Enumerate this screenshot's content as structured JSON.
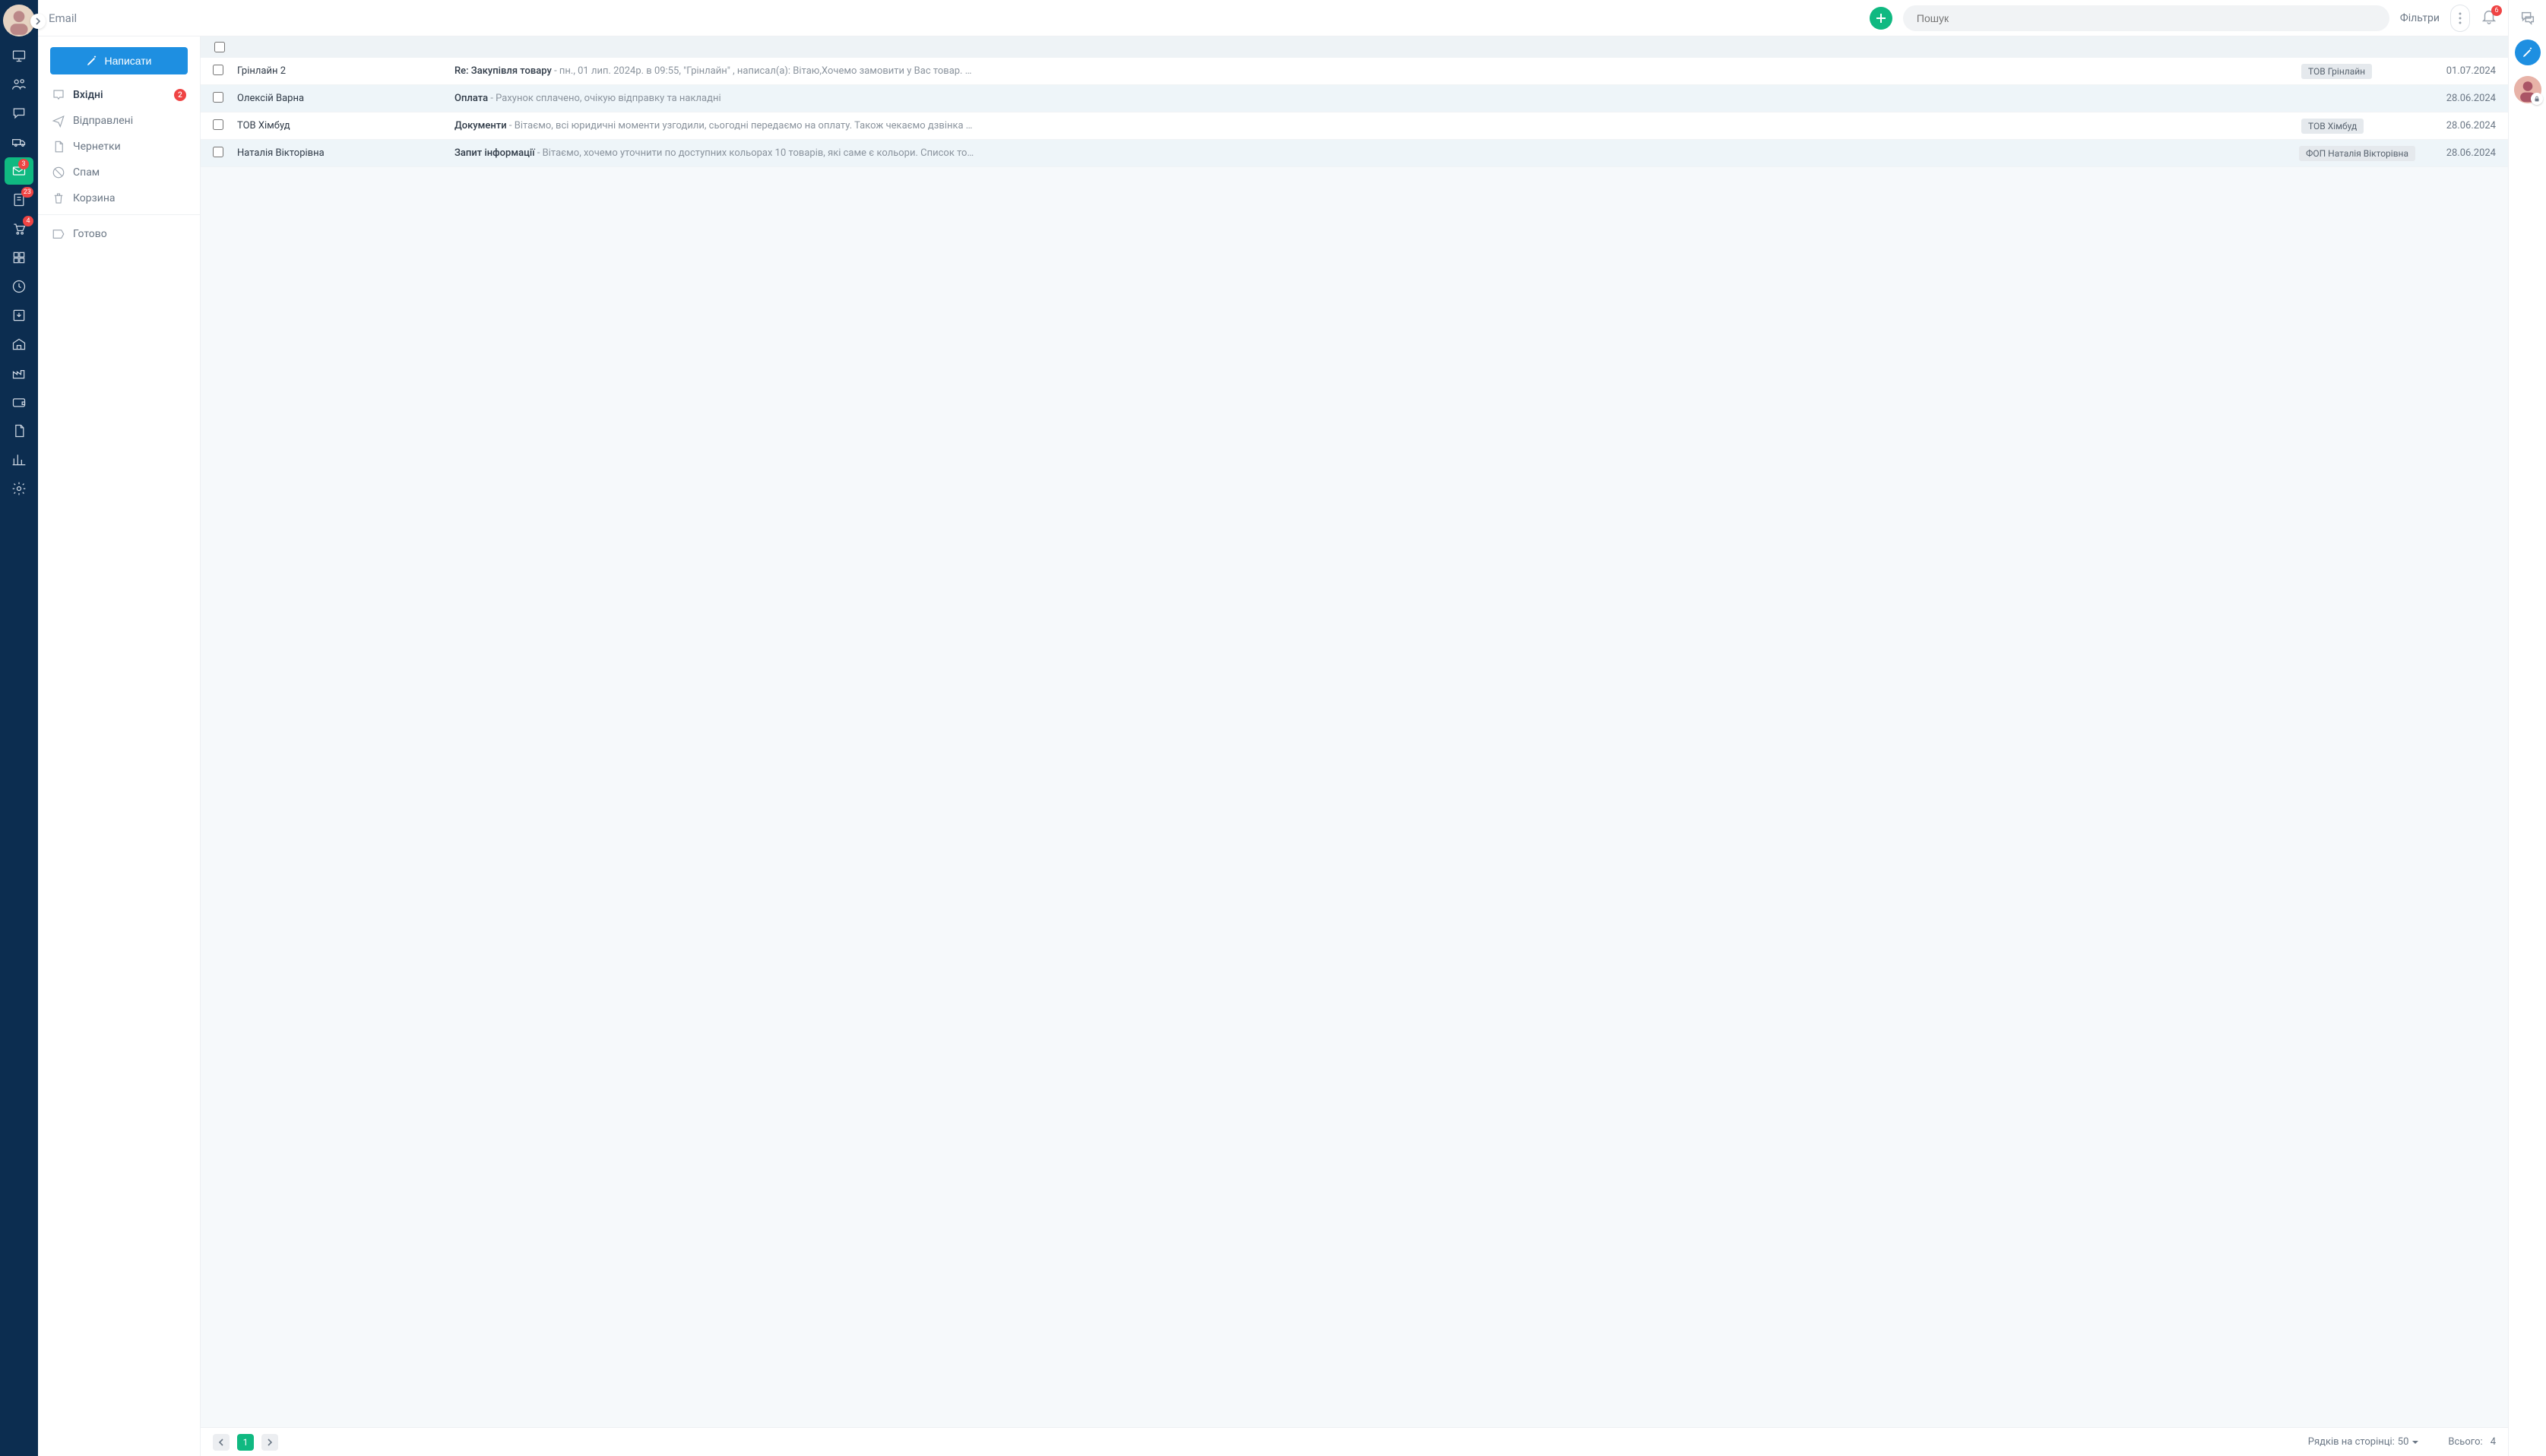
{
  "header": {
    "title": "Email",
    "search_placeholder": "Пошук",
    "filters_label": "Фільтри",
    "bell_count": "6"
  },
  "nav_rail": {
    "badges": {
      "email": "3",
      "notes": "23",
      "cart": "4"
    }
  },
  "compose_label": "Написати",
  "folders": [
    {
      "key": "inbox",
      "label": "Вхідні",
      "count": "2",
      "active": true
    },
    {
      "key": "sent",
      "label": "Відправлені"
    },
    {
      "key": "drafts",
      "label": "Чернетки"
    },
    {
      "key": "spam",
      "label": "Спам"
    },
    {
      "key": "trash",
      "label": "Корзина"
    }
  ],
  "labels": [
    {
      "key": "done",
      "label": "Готово"
    }
  ],
  "emails": [
    {
      "sender": "Грінлайн 2",
      "subject": "Re: Закупівля товару",
      "preview": "пн., 01 лип. 2024р. в 09:55, \"Грінлайн\" , написал(а): Вітаю,Хочемо замовити у Вас товар. …",
      "tag": "ТОВ Грінлайн",
      "date": "01.07.2024"
    },
    {
      "sender": "Олексій Варна",
      "subject": "Оплата",
      "preview": "Рахунок сплачено, очікую відправку та накладні",
      "tag": "",
      "date": "28.06.2024"
    },
    {
      "sender": "ТОВ Хімбуд",
      "subject": "Документи",
      "preview": "Вітаємо, всі юридичні моменти узгодили, сьогодні передаємо на оплату. Також чекаємо дзвінка …",
      "tag": "ТОВ Хімбуд",
      "date": "28.06.2024"
    },
    {
      "sender": "Наталія Вікторівна",
      "subject": "Запит інформації",
      "preview": "Вітаємо, хочемо уточнити по доступних кольорах 10 товарів, які саме є кольори. Список то…",
      "tag": "ФОП Наталія Вікторівна",
      "date": "28.06.2024"
    }
  ],
  "footer": {
    "page_current": "1",
    "per_page_label": "Рядків на сторінці:",
    "per_page_value": "50",
    "total_label": "Всього:",
    "total_value": "4"
  }
}
